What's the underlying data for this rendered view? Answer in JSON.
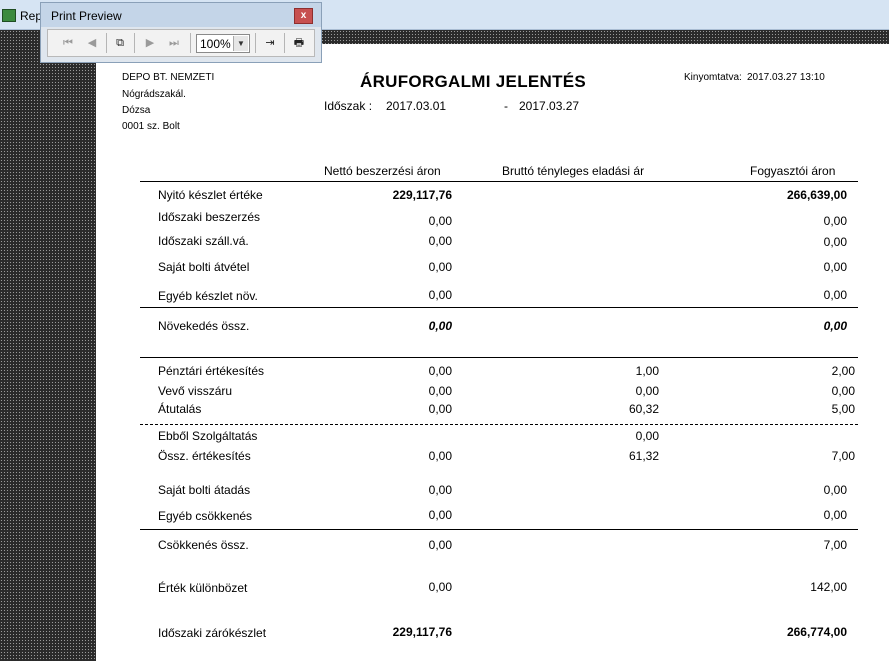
{
  "app": {
    "title": "Rep"
  },
  "preview_toolbar": {
    "title": "Print Preview",
    "close_label": "x",
    "zoom": "100%",
    "buttons": {
      "first": "⏮",
      "prev": "◀",
      "copy": "⧉",
      "next": "▶",
      "last": "⏭",
      "exit": "⇥",
      "print": "🖶"
    }
  },
  "report": {
    "company": "DEPO BT. NEMZETI",
    "city": "Nógrádszakál.",
    "street": "Dózsa",
    "shop": "0001 sz. Bolt",
    "title": "ÁRUFORGALMI JELENTÉS",
    "period_label": "Időszak :",
    "period_from": "2017.03.01",
    "period_dash": "-",
    "period_to": "2017.03.27",
    "printed_label": "Kinyomtatva:",
    "printed_value": "2017.03.27  13:10",
    "columns": {
      "net": "Nettó beszerzési áron",
      "gross": "Bruttó tényleges eladási ár",
      "consumer": "Fogyasztói áron"
    },
    "rows": {
      "opening": {
        "label": "Nyitó készlet értéke",
        "net": "229,117,76",
        "consumer": "266,639,00"
      },
      "purchase": {
        "label": "Időszaki beszerzés",
        "net": "0,00",
        "consumer": "0,00"
      },
      "supplier_return": {
        "label": "Időszaki száll.vá.",
        "net": "0,00",
        "consumer": "0,00"
      },
      "own_receipt": {
        "label": "Saját bolti átvétel",
        "net": "0,00",
        "consumer": "0,00"
      },
      "other_increase": {
        "label": "Egyéb készlet növ.",
        "net": "0,00",
        "consumer": "0,00"
      },
      "increase_total": {
        "label": "Növekedés össz.",
        "net": "0,00",
        "consumer": "0,00"
      },
      "cash_sales": {
        "label": "Pénztári értékesítés",
        "net": "0,00",
        "gross": "1,00",
        "consumer": "2,00"
      },
      "customer_return": {
        "label": "Vevő visszáru",
        "net": "0,00",
        "gross": "0,00",
        "consumer": "0,00"
      },
      "transfer": {
        "label": "Átutalás",
        "net": "0,00",
        "gross": "60,32",
        "consumer": "5,00"
      },
      "services": {
        "label": "Ebből Szolgáltatás",
        "gross": "0,00"
      },
      "sales_total": {
        "label": "Össz. értékesítés",
        "net": "0,00",
        "gross": "61,32",
        "consumer": "7,00"
      },
      "own_handover": {
        "label": "Saját bolti átadás",
        "net": "0,00",
        "consumer": "0,00"
      },
      "other_decrease": {
        "label": "Egyéb csökkenés",
        "net": "0,00",
        "consumer": "0,00"
      },
      "decrease_total": {
        "label": "Csökkenés össz.",
        "net": "0,00",
        "consumer": "7,00"
      },
      "value_diff": {
        "label": "Érték különbözet",
        "net": "0,00",
        "consumer": "142,00"
      },
      "closing": {
        "label": "Időszaki zárókészlet",
        "net": "229,117,76",
        "consumer": "266,774,00"
      }
    }
  }
}
